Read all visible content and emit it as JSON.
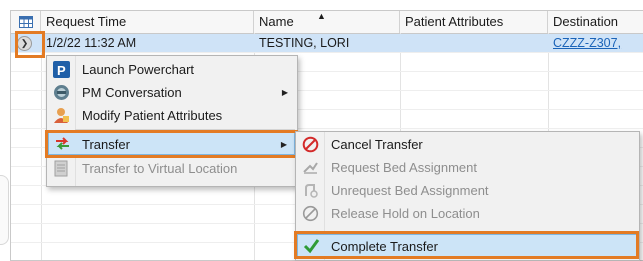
{
  "grid": {
    "columns": [
      {
        "label": ""
      },
      {
        "label": "Request Time"
      },
      {
        "label": "Name"
      },
      {
        "label": "Patient Attributes"
      },
      {
        "label": "Destination"
      }
    ],
    "rows": [
      {
        "request_time": "1/2/22 11:32 AM",
        "name": "TESTING, LORI",
        "patient_attributes": "",
        "destination": "CZZZ-Z307,"
      }
    ],
    "sort_indicator": "▲"
  },
  "context_menu": {
    "items": [
      {
        "label": "Launch Powerchart",
        "icon": "powerchart-icon"
      },
      {
        "label": "PM Conversation",
        "icon": "conversation-icon",
        "submenu_arrow": "▶"
      },
      {
        "label": "Modify Patient Attributes",
        "icon": "modify-attributes-icon"
      },
      {
        "label": "Transfer",
        "icon": "transfer-icon",
        "submenu_arrow": "▶"
      },
      {
        "label": "Transfer to Virtual Location",
        "icon": "virtual-location-icon"
      }
    ]
  },
  "submenu": {
    "items": [
      {
        "label": "Cancel Transfer",
        "icon": "cancel-icon"
      },
      {
        "label": "Request Bed Assignment",
        "icon": "request-bed-icon"
      },
      {
        "label": "Unrequest Bed Assignment",
        "icon": "unrequest-bed-icon"
      },
      {
        "label": "Release Hold on Location",
        "icon": "release-hold-icon"
      },
      {
        "label": "Complete Transfer",
        "icon": "checkmark-icon"
      }
    ]
  },
  "colors": {
    "highlight_border": "#e37b24",
    "selected_row": "#cfe3f7",
    "menu_highlight": "#cce4f7"
  }
}
